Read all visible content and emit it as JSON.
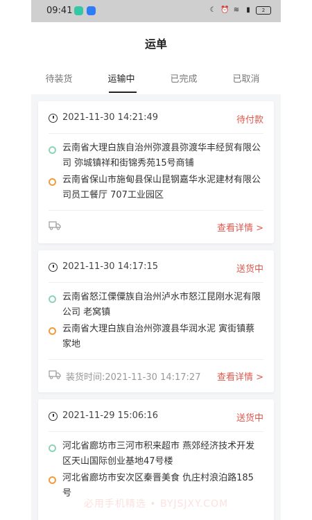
{
  "status_bar": {
    "time": "09:41",
    "battery": "2"
  },
  "header": {
    "title": "运单"
  },
  "tabs": [
    {
      "label": "待装货"
    },
    {
      "label": "运输中"
    },
    {
      "label": "已完成"
    },
    {
      "label": "已取消"
    }
  ],
  "orders": [
    {
      "time": "2021-11-30 14:21:49",
      "status": "待付款",
      "from": "云南省大理白族自治州弥渡县弥渡华丰经贸有限公司 弥城镇祥和街锦秀苑15号商铺",
      "to": "云南省保山市施甸县保山昆钢嘉华水泥建材有限公司员工餐厅 707工业园区",
      "detail_label": "查看详情 >"
    },
    {
      "time": "2021-11-30 14:17:15",
      "status": "送货中",
      "from": "云南省怒江傈僳族自治州泸水市怒江昆刚水泥有限公司 老窝镇",
      "to": "云南省大理白族自治州弥渡县华润水泥 寅街镇蔡家地",
      "ship_time_label": "装货时间:",
      "ship_time_value": "2021-11-30 14:17:27",
      "detail_label": "查看详情 >"
    },
    {
      "time": "2021-11-29 15:06:16",
      "status": "送货中",
      "from": "河北省廊坊市三河市积来超市 燕郊经济技术开发区天山国际创业基地47号楼",
      "to": "河北省廊坊市安次区秦晋美食 仇庄村浪泊路185号"
    }
  ],
  "watermark": "必用手机精选 • BYJSJXY.COM",
  "colors": {
    "accent": "#e2574c",
    "origin_dot": "#8fd3b6",
    "dest_dot": "#f29b3d",
    "status_bar_bg": "#cfcfcf"
  },
  "icons": [
    "clock-icon",
    "truck-icon",
    "wifi-icon",
    "signal-icon",
    "battery-icon",
    "moon-icon",
    "alarm-icon"
  ]
}
